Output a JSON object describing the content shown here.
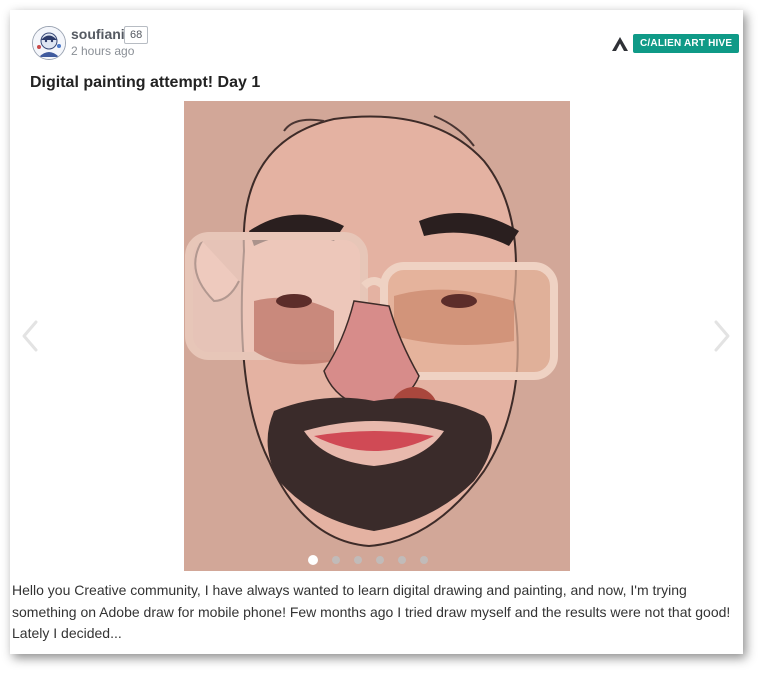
{
  "post": {
    "author": {
      "username": "soufiani",
      "karma": "68",
      "avatar_icon": "avatar-illustration-icon"
    },
    "timestamp": "2 hours ago",
    "community": {
      "badge_label": "C/ALIEN ART HIVE",
      "logo_icon": "alien-logo-icon",
      "badge_color": "#0f9a87"
    },
    "title": "Digital painting attempt! Day 1",
    "image": {
      "alt": "",
      "background_color": "#d2a798"
    },
    "carousel": {
      "prev_icon": "chevron-left-icon",
      "next_icon": "chevron-right-icon",
      "total_slides": 6,
      "active_slide": 1
    },
    "body": "Hello you Creative community, I have always wanted to learn digital drawing and painting, and now, I'm trying something on Adobe draw for mobile phone! Few months ago I tried draw myself and the results were not that good! Lately I decided..."
  }
}
